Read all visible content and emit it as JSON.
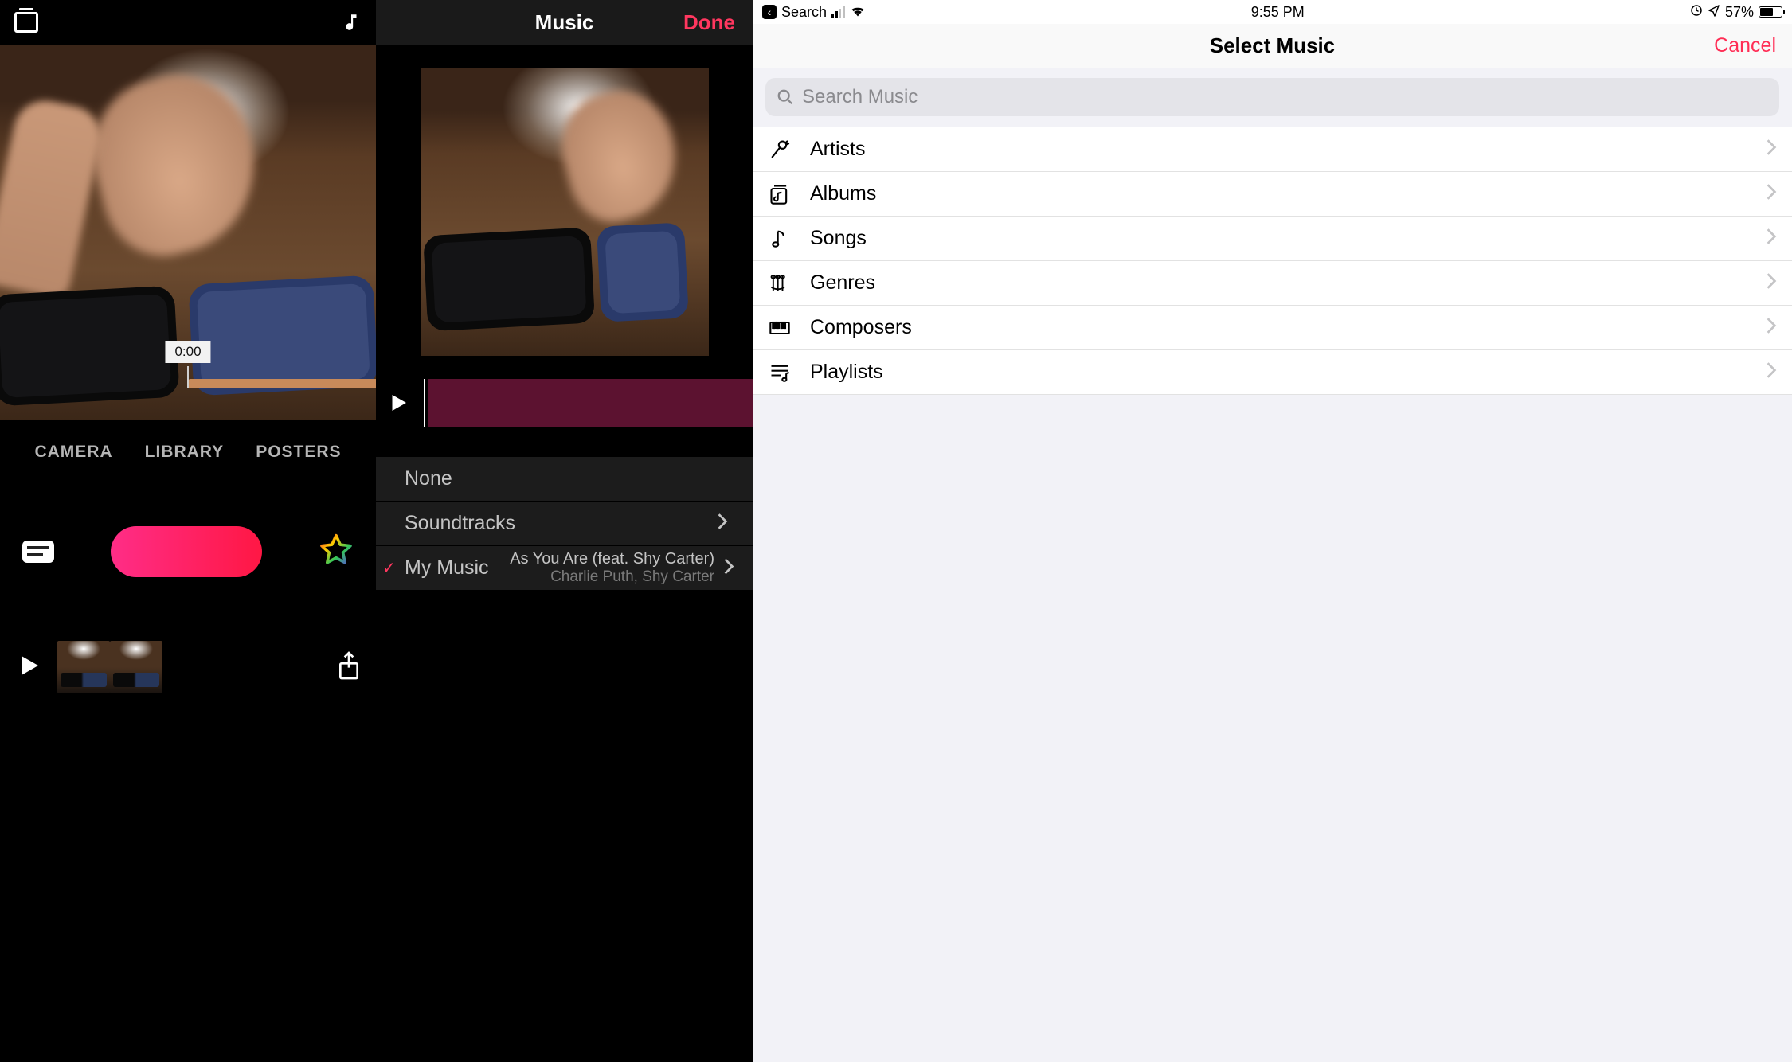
{
  "pane1": {
    "timecode": "0:00",
    "tabs": {
      "camera": "CAMERA",
      "library": "LIBRARY",
      "posters": "POSTERS"
    }
  },
  "pane2": {
    "nav": {
      "title": "Music",
      "done": "Done"
    },
    "options": {
      "none": "None",
      "soundtracks": "Soundtracks",
      "my_music": {
        "label": "My Music",
        "song": "As You Are (feat. Shy Carter)",
        "artist": "Charlie Puth, Shy Carter"
      }
    }
  },
  "pane3": {
    "status": {
      "back": "Search",
      "time": "9:55 PM",
      "battery": "57%"
    },
    "nav": {
      "title": "Select Music",
      "cancel": "Cancel"
    },
    "search_placeholder": "Search Music",
    "categories": {
      "artists": "Artists",
      "albums": "Albums",
      "songs": "Songs",
      "genres": "Genres",
      "composers": "Composers",
      "playlists": "Playlists"
    }
  }
}
